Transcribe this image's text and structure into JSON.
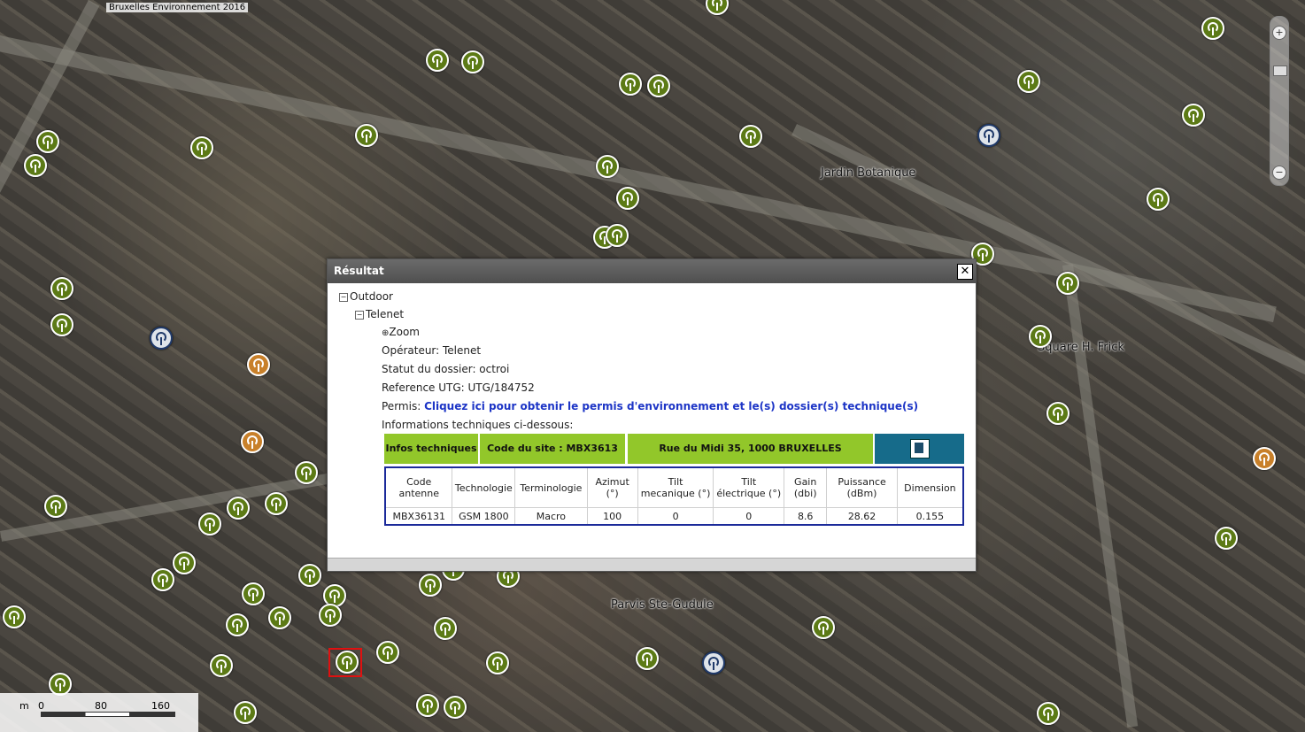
{
  "map": {
    "copyright": "Bruxelles Environnement 2016",
    "labels": [
      "Jardin Botanique",
      "Square H. Frick",
      "Parvis Ste-Gudule"
    ],
    "scale": {
      "unit": "m",
      "ticks": [
        "0",
        "80",
        "160"
      ]
    },
    "zoom": {
      "in": "+",
      "out": "−"
    }
  },
  "result": {
    "title": "Résultat",
    "close": "✕",
    "tree": {
      "outdoor": "Outdoor",
      "operator_node": "Telenet",
      "zoom": "Zoom",
      "operateur": "Opérateur: Telenet",
      "statut": "Statut du dossier: octroi",
      "reference": "Reference UTG: UTG/184752",
      "permis_label": "Permis:",
      "permis_link": "Cliquez ici pour obtenir le permis d'environnement et le(s) dossier(s) technique(s)",
      "infos": "Informations techniques ci-dessous:"
    },
    "info_bar": {
      "infos": "Infos techniques",
      "site": "Code du site : MBX3613",
      "address": "Rue du Midi 35, 1000 BRUXELLES"
    },
    "table": {
      "headers": [
        "Code antenne",
        "Technologie",
        "Terminologie",
        "Azimut (°)",
        "Tilt mecanique (°)",
        "Tilt électrique (°)",
        "Gain (dbi)",
        "Puissance (dBm)",
        "Dimension"
      ],
      "rows": [
        [
          "MBX36131",
          "GSM 1800",
          "Macro",
          "100",
          "0",
          "0",
          "8.6",
          "28.62",
          "0.155"
        ]
      ]
    }
  },
  "colors": {
    "marker_green": "#5c7a16",
    "marker_orange": "#c8802a",
    "info_bar": "#92c72a",
    "pdf_bar": "#166b8a",
    "link": "#1d35c6",
    "selection": "#e01010"
  }
}
